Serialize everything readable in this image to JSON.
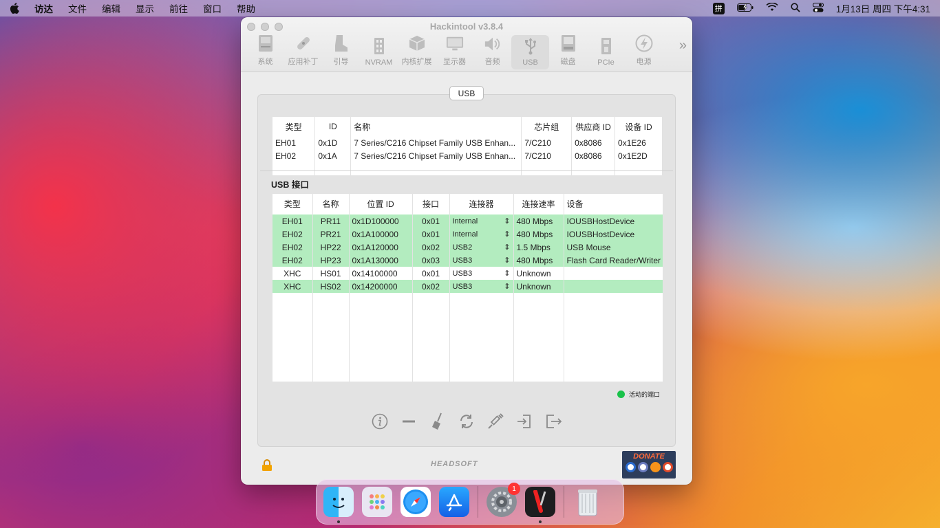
{
  "menubar": {
    "items": [
      "访达",
      "文件",
      "编辑",
      "显示",
      "前往",
      "窗口",
      "帮助"
    ],
    "ime": "拼",
    "datetime": "1月13日 周四 下午4:31"
  },
  "window": {
    "title": "Hackintool v3.8.4",
    "toolbar": [
      {
        "label": "系统",
        "icon": "computer-icon"
      },
      {
        "label": "应用补丁",
        "icon": "bandage-icon"
      },
      {
        "label": "引导",
        "icon": "boot-icon"
      },
      {
        "label": "NVRAM",
        "icon": "nvram-chip-icon"
      },
      {
        "label": "内核扩展",
        "icon": "kext-box-icon"
      },
      {
        "label": "显示器",
        "icon": "monitor-icon"
      },
      {
        "label": "音频",
        "icon": "speaker-icon"
      },
      {
        "label": "USB",
        "icon": "usb-icon"
      },
      {
        "label": "磁盘",
        "icon": "disk-icon"
      },
      {
        "label": "PCIe",
        "icon": "pcie-icon"
      },
      {
        "label": "电源",
        "icon": "power-bolt-icon"
      }
    ],
    "active_tab": "USB",
    "section_pill": "USB"
  },
  "controllers": {
    "headers": [
      "类型",
      "ID",
      "名称",
      "芯片组",
      "供应商 ID",
      "设备 ID"
    ],
    "rows": [
      [
        "EH01",
        "0x1D",
        "7 Series/C216 Chipset Family USB Enhan...",
        "7/C210",
        "0x8086",
        "0x1E26"
      ],
      [
        "EH02",
        "0x1A",
        "7 Series/C216 Chipset Family USB Enhan...",
        "7/C210",
        "0x8086",
        "0x1E2D"
      ]
    ]
  },
  "ports": {
    "title": "USB 接口",
    "headers": [
      "类型",
      "名称",
      "位置 ID",
      "接口",
      "连接器",
      "连接速率",
      "设备"
    ],
    "rows": [
      {
        "cells": [
          "EH01",
          "PR11",
          "0x1D100000",
          "0x01",
          "Internal",
          "480 Mbps",
          "IOUSBHostDevice"
        ],
        "active": true
      },
      {
        "cells": [
          "EH02",
          "PR21",
          "0x1A100000",
          "0x01",
          "Internal",
          "480 Mbps",
          "IOUSBHostDevice"
        ],
        "active": true
      },
      {
        "cells": [
          "EH02",
          "HP22",
          "0x1A120000",
          "0x02",
          "USB2",
          "1.5 Mbps",
          "USB Mouse"
        ],
        "active": true
      },
      {
        "cells": [
          "EH02",
          "HP23",
          "0x1A130000",
          "0x03",
          "USB3",
          "480 Mbps",
          "Flash Card Reader/Writer"
        ],
        "active": true
      },
      {
        "cells": [
          "XHC",
          "HS01",
          "0x14100000",
          "0x01",
          "USB3",
          "Unknown",
          ""
        ],
        "active": false
      },
      {
        "cells": [
          "XHC",
          "HS02",
          "0x14200000",
          "0x02",
          "USB3",
          "Unknown",
          ""
        ],
        "active": true
      }
    ],
    "legend": "活动的端口"
  },
  "footer": {
    "brand": "HEADSOFT",
    "donate": "DONATE"
  },
  "dock": {
    "apps": [
      {
        "name": "finder",
        "running": true
      },
      {
        "name": "launchpad",
        "running": false
      },
      {
        "name": "safari",
        "running": false
      },
      {
        "name": "app-store",
        "running": false
      },
      {
        "name": "system-preferences",
        "running": false,
        "badge": "1"
      },
      {
        "name": "hackintool",
        "running": true
      },
      {
        "name": "trash",
        "running": false
      }
    ]
  },
  "colors": {
    "active_row": "#b3ecbf",
    "legend_dot": "#19c24a",
    "donate_bg": "#2d3d5c"
  }
}
